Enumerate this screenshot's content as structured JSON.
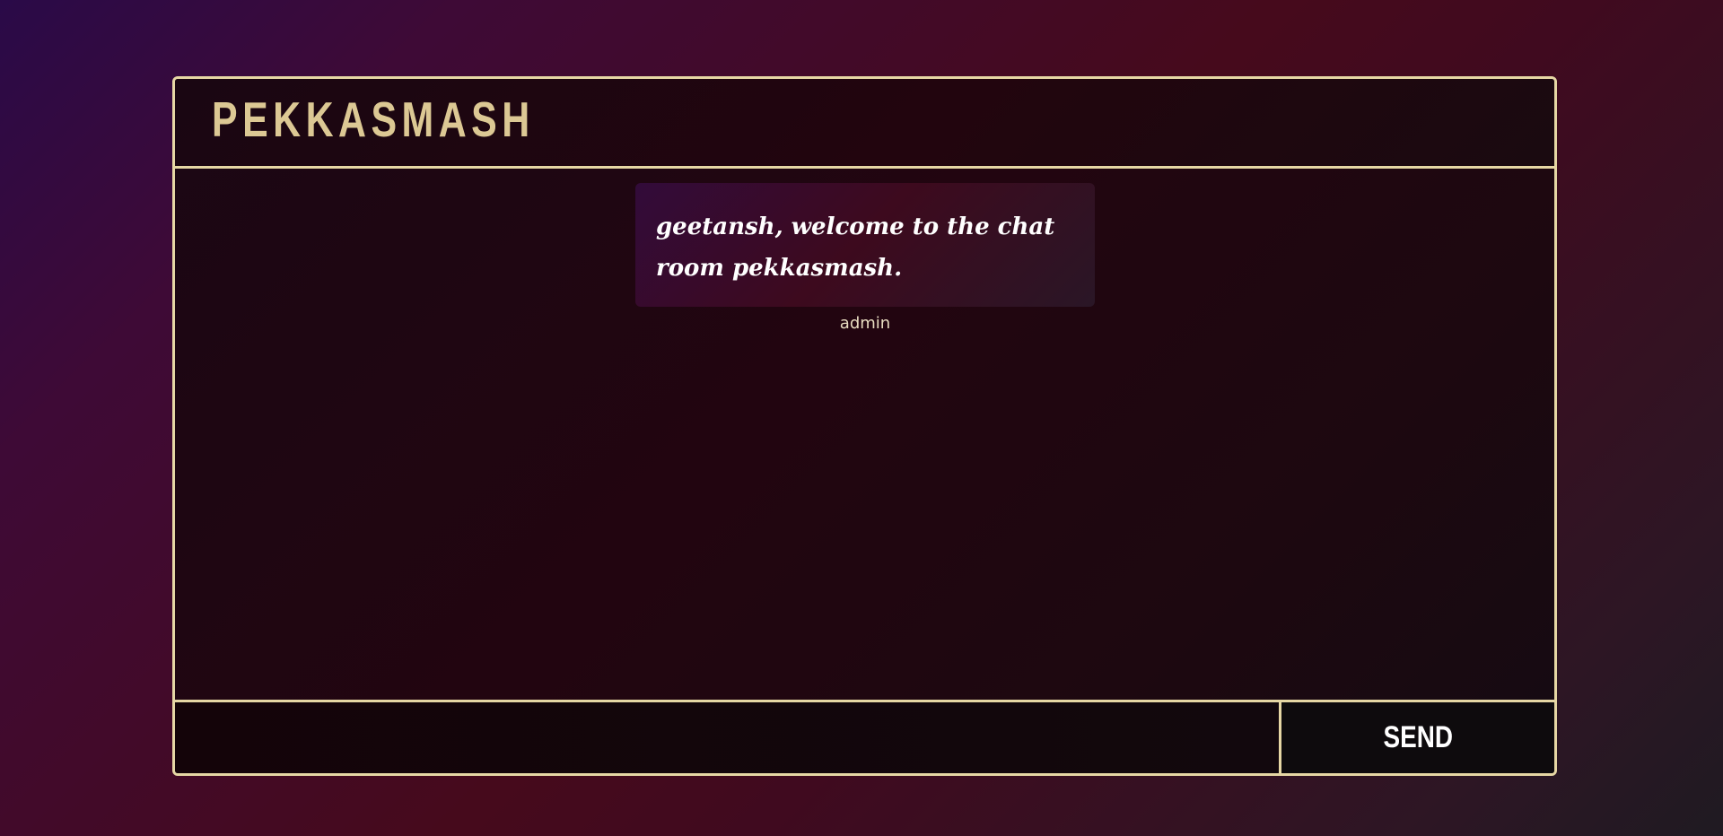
{
  "room": {
    "title": "PEKKASMASH"
  },
  "messages": [
    {
      "text": "geetansh, welcome to the chat room pekkasmash.",
      "sender": "admin"
    }
  ],
  "composer": {
    "input_value": "",
    "send_label": "SEND"
  },
  "colors": {
    "accent_border": "#e6d7a4",
    "title_text": "#dcc894",
    "bubble_text": "#ffffff"
  }
}
